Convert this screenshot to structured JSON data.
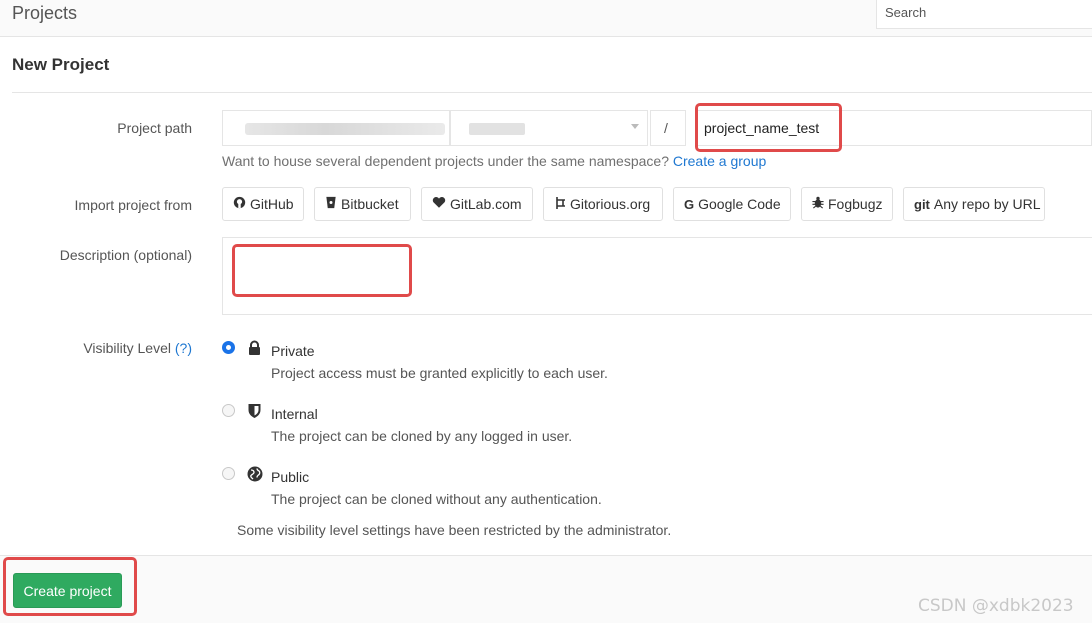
{
  "header": {
    "title": "Projects",
    "search_placeholder": "Search"
  },
  "page": {
    "heading": "New Project"
  },
  "form": {
    "project_path": {
      "label": "Project path",
      "separator": "/",
      "name_value": "project_name_test",
      "hint": "Want to house several dependent projects under the same namespace?",
      "hint_link": "Create a group"
    },
    "import": {
      "label": "Import project from",
      "sources": [
        {
          "label": "GitHub",
          "icon": "github-icon"
        },
        {
          "label": "Bitbucket",
          "icon": "bitbucket-icon"
        },
        {
          "label": "GitLab.com",
          "icon": "heart-icon"
        },
        {
          "label": "Gitorious.org",
          "icon": "gitorious-icon"
        },
        {
          "label": "Google Code",
          "icon": "google-icon"
        },
        {
          "label": "Fogbugz",
          "icon": "bug-icon"
        },
        {
          "label": "Any repo by URL",
          "icon": "git-icon"
        }
      ]
    },
    "description": {
      "label": "Description (optional)",
      "value": ""
    },
    "visibility": {
      "label": "Visibility Level",
      "help": "(?)",
      "options": [
        {
          "title": "Private",
          "description": "Project access must be granted explicitly to each user.",
          "icon": "lock-icon",
          "selected": true
        },
        {
          "title": "Internal",
          "description": "The project can be cloned by any logged in user.",
          "icon": "shield-icon",
          "selected": false
        },
        {
          "title": "Public",
          "description": "The project can be cloned without any authentication.",
          "icon": "globe-icon",
          "selected": false
        }
      ],
      "restriction_note": "Some visibility level settings have been restricted by the administrator."
    }
  },
  "footer": {
    "create_label": "Create project"
  },
  "watermark": "CSDN @xdbk2023",
  "colors": {
    "accent_green": "#2faa60",
    "link_blue": "#1f78d1",
    "highlight_red": "#e04a4a"
  }
}
